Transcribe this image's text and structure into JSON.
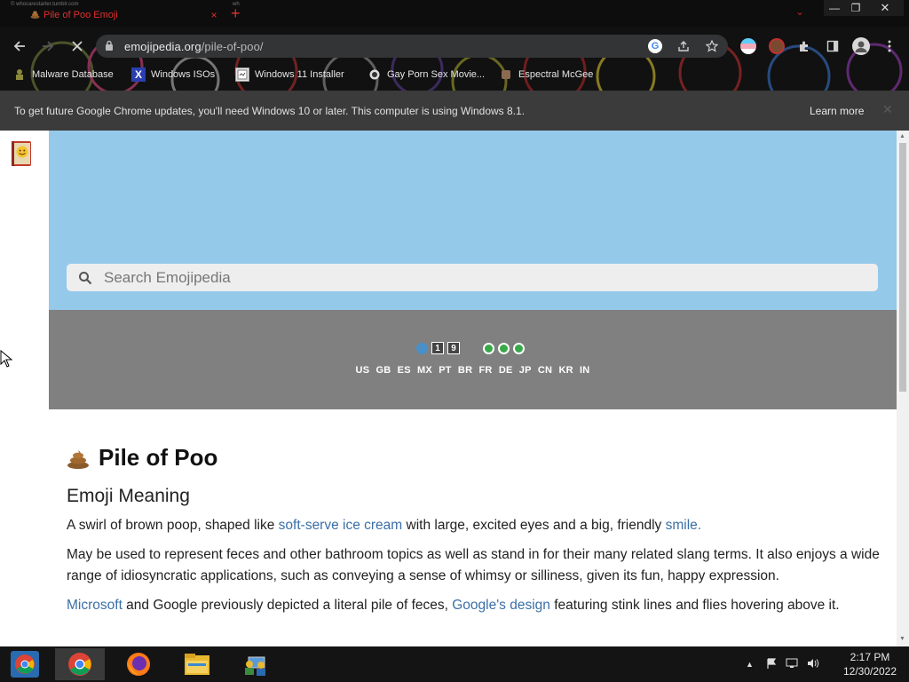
{
  "browser": {
    "tab_tiny_text_1": "© whocarestarter.tumblr.com",
    "tab_tiny_text_2": "wh",
    "tab_title": "Pile of Poo Emoji",
    "tab_close": "×",
    "new_tab": "+",
    "tab_search": "⌄",
    "window_controls": {
      "minimize": "—",
      "maximize": "❐",
      "close": "✕"
    },
    "url_domain": "emojipedia.org",
    "url_path": "/pile-of-poo/",
    "bookmarks": [
      {
        "label": "Malware Database",
        "icon": "malware-db-icon"
      },
      {
        "label": "Windows ISOs",
        "icon": "x-logo-icon"
      },
      {
        "label": "Windows 11 Installer",
        "icon": "installer-icon"
      },
      {
        "label": "Gay Porn Sex Movie...",
        "icon": "page-icon"
      },
      {
        "label": "Espectral McGee",
        "icon": "page-icon"
      }
    ]
  },
  "infobar": {
    "message": "To get future Google Chrome updates, you'll need Windows 10 or later. This computer is using Windows 8.1.",
    "learn_more": "Learn more",
    "close": "✕"
  },
  "page": {
    "search_placeholder": "Search Emojipedia",
    "banner_numbers": [
      "1",
      "9"
    ],
    "countries": [
      "US",
      "GB",
      "ES",
      "MX",
      "PT",
      "BR",
      "FR",
      "DE",
      "JP",
      "CN",
      "KR",
      "IN"
    ],
    "title": "Pile of Poo",
    "subtitle": "Emoji Meaning",
    "p1_a": "A swirl of brown poop, shaped like ",
    "p1_link1": "soft-serve ice cream",
    "p1_b": " with large, excited eyes and a big, friendly ",
    "p1_link2": "smile.",
    "p2": "May be used to represent feces and other bathroom topics as well as stand in for their many related slang terms. It also enjoys a wide range of idiosyncratic applications, such as conveying a sense of whimsy or silliness, given its fun, happy expression.",
    "p3_link1": "Microsoft",
    "p3_a": " and Google previously depicted a literal pile of feces, ",
    "p3_link2": "Google's design",
    "p3_b": " featuring stink lines and flies hovering above it."
  },
  "taskbar": {
    "time": "2:17 PM",
    "date": "12/30/2022",
    "apps": [
      "chrome-legacy-icon",
      "chrome-icon",
      "firefox-icon",
      "file-explorer-icon",
      "network-people-icon"
    ]
  },
  "colors": {
    "hero": "#94c9ea",
    "banner": "#808080",
    "link": "#3a6fa6",
    "tab_text": "#e03030"
  }
}
